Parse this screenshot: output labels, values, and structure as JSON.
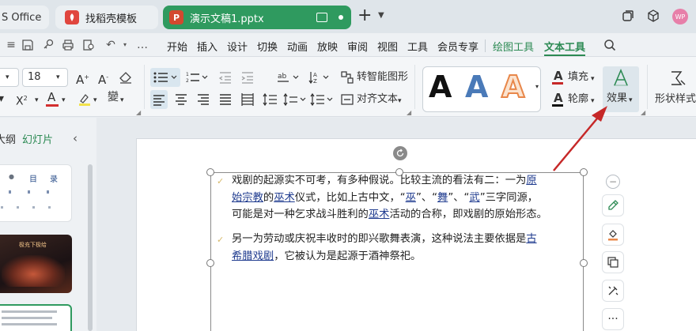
{
  "tabs": {
    "office_label": "S Office",
    "template_label": "找稻壳模板",
    "doc_label": "演示文稿1.pptx",
    "template_logo": "",
    "doc_logo": "P",
    "avatar_initials": "WP"
  },
  "menu": {
    "items": [
      "开始",
      "插入",
      "设计",
      "切换",
      "动画",
      "放映",
      "审阅",
      "视图",
      "工具",
      "会员专享",
      "绘图工具",
      "文本工具"
    ],
    "active": "文本工具"
  },
  "ribbon": {
    "font_size": "18",
    "smart_graphic": "转智能图形",
    "align_text": "对齐文本",
    "fill": "填充",
    "outline": "轮廓",
    "effect": "效果",
    "shape_style": "形状样式",
    "accent_color": "#2c8a53",
    "style_previews": [
      "A",
      "A",
      "A"
    ]
  },
  "left_panel": {
    "outline_tab": "大纲",
    "slides_tab": "幻灯片",
    "thumb1_text": [
      "目",
      "录"
    ],
    "thumb2_title": "极充下极给"
  },
  "slide": {
    "p1_line1_pre": "戏剧的起源实不可考，有多种假说。比较主流的看法有二：一为",
    "p1_line1_link": "原",
    "p1_line2_link1": "始宗教",
    "p1_line2_mid1": "的",
    "p1_line2_link2": "巫术",
    "p1_line2_mid2": "仪式，比如上古中文，“",
    "p1_line2_link3": "巫",
    "p1_line2_mid3": "”、“",
    "p1_line2_link4": "舞",
    "p1_line2_mid4": "”、“",
    "p1_line2_link5": "武",
    "p1_line2_end": "”三字同源，",
    "p1_line3_pre": "可能是对一种乞求战斗胜利的",
    "p1_line3_link": "巫术",
    "p1_line3_end": "活动的合称，即戏剧的原始形态。",
    "p2_line1_pre": "另一为劳动或庆祝丰收时的即兴歌舞表演，这种说法主要依据是",
    "p2_line1_link": "古",
    "p2_line2_link": "希腊戏剧",
    "p2_line2_end": "，它被认为是起源于酒神祭祀。"
  },
  "colors": {
    "arrow": "#c62828",
    "doc_tab": "#2f9a5f"
  }
}
